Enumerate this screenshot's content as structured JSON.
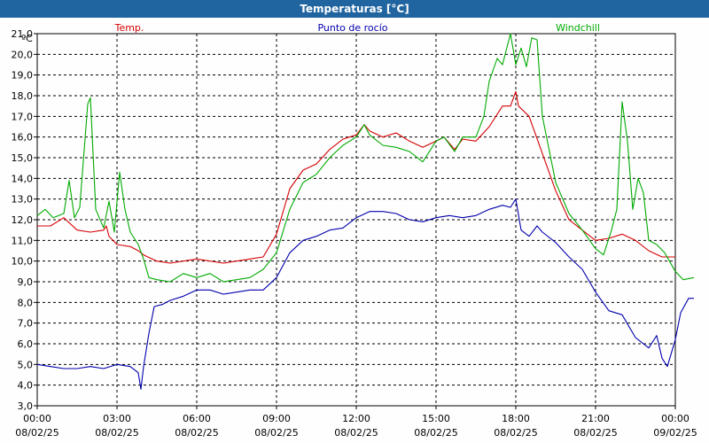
{
  "title": "Temperaturas [°C]",
  "unit_label": "ºC",
  "chart_data": {
    "type": "line",
    "title": "Temperaturas [°C]",
    "ylabel": "ºC",
    "ylim": [
      3.0,
      21.0
    ],
    "yticks": [
      "3,0",
      "4,0",
      "5,0",
      "6,0",
      "7,0",
      "8,0",
      "9,0",
      "10,0",
      "11,0",
      "12,0",
      "13,0",
      "14,0",
      "15,0",
      "16,0",
      "17,0",
      "18,0",
      "19,0",
      "20,0",
      "21,0"
    ],
    "xlim_hours": [
      0,
      24
    ],
    "xticks": [
      {
        "time": "00:00",
        "date": "08/02/25"
      },
      {
        "time": "03:00",
        "date": "08/02/25"
      },
      {
        "time": "06:00",
        "date": "08/02/25"
      },
      {
        "time": "09:00",
        "date": "08/02/25"
      },
      {
        "time": "12:00",
        "date": "08/02/25"
      },
      {
        "time": "15:00",
        "date": "08/02/25"
      },
      {
        "time": "18:00",
        "date": "08/02/25"
      },
      {
        "time": "21:00",
        "date": "08/02/25"
      },
      {
        "time": "00:00",
        "date": "09/02/25"
      }
    ],
    "grid": true,
    "legend_position": "top",
    "series": [
      {
        "name": "Temp.",
        "color": "#d40000",
        "points": [
          [
            0.0,
            11.7
          ],
          [
            0.5,
            11.7
          ],
          [
            1.0,
            12.1
          ],
          [
            1.5,
            11.5
          ],
          [
            2.0,
            11.4
          ],
          [
            2.5,
            11.5
          ],
          [
            2.6,
            11.7
          ],
          [
            2.7,
            11.2
          ],
          [
            3.0,
            10.8
          ],
          [
            3.5,
            10.7
          ],
          [
            3.8,
            10.5
          ],
          [
            4.0,
            10.3
          ],
          [
            4.5,
            10.0
          ],
          [
            5.0,
            9.9
          ],
          [
            6.0,
            10.1
          ],
          [
            7.0,
            9.9
          ],
          [
            8.0,
            10.1
          ],
          [
            8.5,
            10.2
          ],
          [
            9.0,
            11.3
          ],
          [
            9.5,
            13.5
          ],
          [
            10.0,
            14.4
          ],
          [
            10.5,
            14.7
          ],
          [
            11.0,
            15.4
          ],
          [
            11.5,
            15.9
          ],
          [
            12.0,
            16.1
          ],
          [
            12.3,
            16.6
          ],
          [
            12.5,
            16.3
          ],
          [
            13.0,
            16.0
          ],
          [
            13.5,
            16.2
          ],
          [
            14.0,
            15.8
          ],
          [
            14.5,
            15.5
          ],
          [
            15.0,
            15.8
          ],
          [
            15.3,
            16.0
          ],
          [
            15.7,
            15.4
          ],
          [
            16.0,
            15.9
          ],
          [
            16.5,
            15.8
          ],
          [
            17.0,
            16.5
          ],
          [
            17.5,
            17.5
          ],
          [
            17.8,
            17.5
          ],
          [
            18.0,
            18.2
          ],
          [
            18.1,
            17.5
          ],
          [
            18.5,
            17.0
          ],
          [
            19.0,
            15.2
          ],
          [
            19.5,
            13.4
          ],
          [
            20.0,
            12.0
          ],
          [
            20.5,
            11.5
          ],
          [
            21.0,
            11.0
          ],
          [
            21.5,
            11.1
          ],
          [
            22.0,
            11.3
          ],
          [
            22.5,
            11.0
          ],
          [
            23.0,
            10.5
          ],
          [
            23.5,
            10.2
          ],
          [
            24.0,
            10.2
          ]
        ]
      },
      {
        "name": "Punto de rocío",
        "color": "#0000aa",
        "points": [
          [
            0.0,
            5.0
          ],
          [
            0.5,
            4.9
          ],
          [
            1.0,
            4.8
          ],
          [
            1.5,
            4.8
          ],
          [
            2.0,
            4.9
          ],
          [
            2.5,
            4.8
          ],
          [
            3.0,
            5.0
          ],
          [
            3.5,
            4.9
          ],
          [
            3.8,
            4.6
          ],
          [
            3.9,
            3.8
          ],
          [
            4.0,
            4.9
          ],
          [
            4.2,
            6.5
          ],
          [
            4.4,
            7.8
          ],
          [
            4.7,
            7.9
          ],
          [
            5.0,
            8.1
          ],
          [
            5.5,
            8.3
          ],
          [
            6.0,
            8.6
          ],
          [
            6.5,
            8.6
          ],
          [
            7.0,
            8.4
          ],
          [
            7.5,
            8.5
          ],
          [
            8.0,
            8.6
          ],
          [
            8.5,
            8.6
          ],
          [
            9.0,
            9.2
          ],
          [
            9.5,
            10.4
          ],
          [
            10.0,
            11.0
          ],
          [
            10.5,
            11.2
          ],
          [
            11.0,
            11.5
          ],
          [
            11.5,
            11.6
          ],
          [
            12.0,
            12.1
          ],
          [
            12.5,
            12.4
          ],
          [
            13.0,
            12.4
          ],
          [
            13.5,
            12.3
          ],
          [
            14.0,
            12.0
          ],
          [
            14.5,
            11.9
          ],
          [
            15.0,
            12.1
          ],
          [
            15.5,
            12.2
          ],
          [
            16.0,
            12.1
          ],
          [
            16.5,
            12.2
          ],
          [
            17.0,
            12.5
          ],
          [
            17.5,
            12.7
          ],
          [
            17.8,
            12.6
          ],
          [
            18.0,
            13.0
          ],
          [
            18.2,
            11.5
          ],
          [
            18.5,
            11.2
          ],
          [
            18.8,
            11.7
          ],
          [
            19.0,
            11.4
          ],
          [
            19.5,
            10.9
          ],
          [
            20.0,
            10.2
          ],
          [
            20.5,
            9.6
          ],
          [
            21.0,
            8.5
          ],
          [
            21.5,
            7.6
          ],
          [
            22.0,
            7.4
          ],
          [
            22.5,
            6.3
          ],
          [
            23.0,
            5.8
          ],
          [
            23.3,
            6.4
          ],
          [
            23.5,
            5.3
          ],
          [
            23.7,
            4.9
          ],
          [
            24.0,
            6.2
          ],
          [
            24.2,
            7.5
          ],
          [
            24.5,
            8.2
          ],
          [
            24.7,
            8.2
          ]
        ]
      },
      {
        "name": "Windchill",
        "color": "#00aa00",
        "points": [
          [
            0.0,
            12.2
          ],
          [
            0.3,
            12.5
          ],
          [
            0.6,
            12.1
          ],
          [
            1.0,
            12.3
          ],
          [
            1.2,
            13.9
          ],
          [
            1.4,
            12.1
          ],
          [
            1.6,
            12.6
          ],
          [
            1.9,
            17.6
          ],
          [
            2.0,
            17.9
          ],
          [
            2.2,
            12.5
          ],
          [
            2.5,
            11.6
          ],
          [
            2.7,
            12.9
          ],
          [
            2.9,
            11.4
          ],
          [
            3.1,
            14.3
          ],
          [
            3.3,
            12.5
          ],
          [
            3.5,
            11.4
          ],
          [
            3.8,
            10.8
          ],
          [
            4.0,
            10.1
          ],
          [
            4.2,
            9.2
          ],
          [
            4.5,
            9.1
          ],
          [
            5.0,
            9.0
          ],
          [
            5.5,
            9.4
          ],
          [
            6.0,
            9.2
          ],
          [
            6.5,
            9.4
          ],
          [
            7.0,
            9.0
          ],
          [
            7.5,
            9.1
          ],
          [
            8.0,
            9.2
          ],
          [
            8.5,
            9.6
          ],
          [
            9.0,
            10.4
          ],
          [
            9.5,
            12.5
          ],
          [
            10.0,
            13.8
          ],
          [
            10.5,
            14.2
          ],
          [
            11.0,
            15.0
          ],
          [
            11.5,
            15.6
          ],
          [
            12.0,
            16.0
          ],
          [
            12.3,
            16.6
          ],
          [
            12.5,
            16.1
          ],
          [
            13.0,
            15.6
          ],
          [
            13.5,
            15.5
          ],
          [
            14.0,
            15.3
          ],
          [
            14.5,
            14.8
          ],
          [
            15.0,
            15.8
          ],
          [
            15.3,
            16.0
          ],
          [
            15.7,
            15.3
          ],
          [
            16.0,
            16.0
          ],
          [
            16.5,
            16.0
          ],
          [
            16.8,
            17.0
          ],
          [
            17.0,
            18.7
          ],
          [
            17.3,
            19.8
          ],
          [
            17.5,
            19.5
          ],
          [
            17.8,
            21.0
          ],
          [
            18.0,
            19.5
          ],
          [
            18.2,
            20.3
          ],
          [
            18.4,
            19.4
          ],
          [
            18.6,
            20.8
          ],
          [
            18.8,
            20.7
          ],
          [
            19.0,
            17.0
          ],
          [
            19.5,
            13.8
          ],
          [
            20.0,
            12.3
          ],
          [
            20.5,
            11.5
          ],
          [
            21.0,
            10.6
          ],
          [
            21.3,
            10.3
          ],
          [
            21.6,
            11.5
          ],
          [
            21.8,
            12.5
          ],
          [
            22.0,
            17.7
          ],
          [
            22.2,
            15.8
          ],
          [
            22.4,
            12.5
          ],
          [
            22.6,
            14.0
          ],
          [
            22.8,
            13.3
          ],
          [
            23.0,
            11.0
          ],
          [
            23.3,
            10.8
          ],
          [
            23.6,
            10.4
          ],
          [
            24.0,
            9.5
          ],
          [
            24.3,
            9.1
          ],
          [
            24.7,
            9.2
          ]
        ]
      }
    ]
  }
}
